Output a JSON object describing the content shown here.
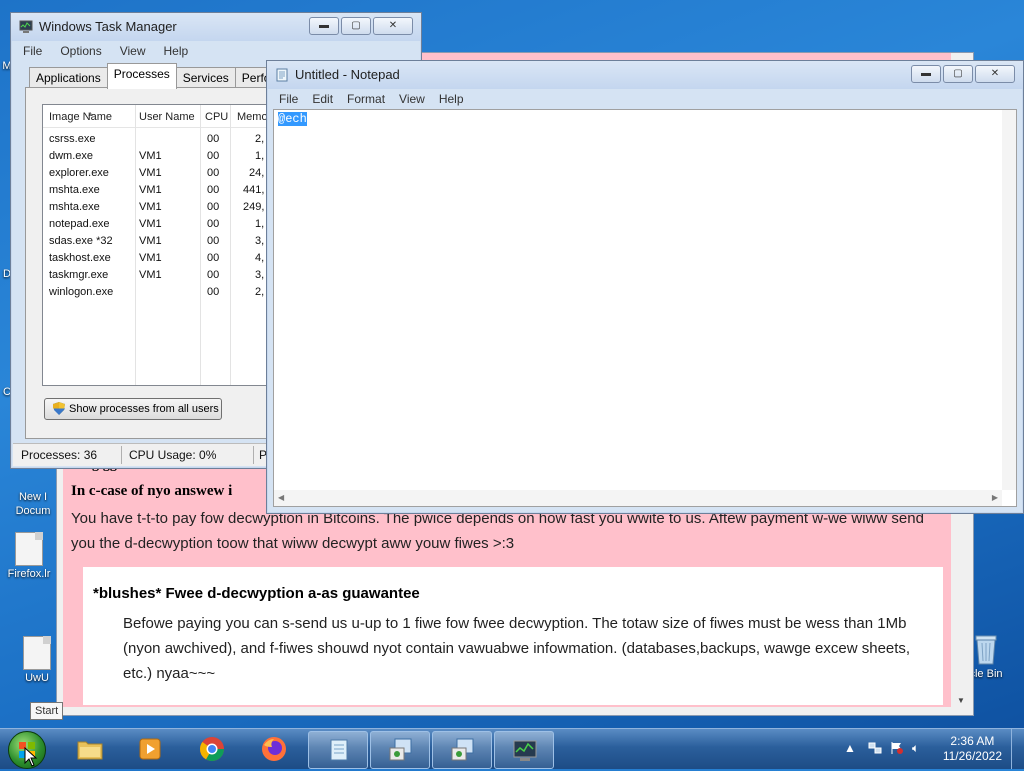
{
  "desktop": {
    "icons": [
      {
        "label": "M",
        "id": "m"
      },
      {
        "label": "D",
        "id": "d"
      },
      {
        "label": "C",
        "id": "c"
      },
      {
        "label": "New I\nDocum",
        "id": "newdoc"
      },
      {
        "label": "Firefox.lr",
        "id": "firefox"
      },
      {
        "label": "UwU",
        "id": "uwu"
      },
      {
        "label": "cle Bin",
        "id": "recycle"
      }
    ]
  },
  "ransom": {
    "partial_heading": "*giggles* W-write this ID i",
    "heading": "In c-case of nyo answew i",
    "text": "You have t-t-to pay fow decwyption in Bitcoins. The pwice depends on how fast you wwite to us. Aftew payment w-we wiww send you the d-decwyption toow that wiww decwypt aww youw fiwes >:3",
    "box_title": "*blushes* Fwee d-decwyption a-as guawantee",
    "box_text": "Befowe paying you can s-send us u-up to 1 fiwe fow fwee decwyption. The totaw size of fiwes must be wess than 1Mb (nyon awchived), and f-fiwes shouwd nyot contain vawuabwe infowmation. (databases,backups, wawge excew sheets, etc.) nyaa~~~"
  },
  "taskmgr": {
    "title": "Windows Task Manager",
    "menu": [
      "File",
      "Options",
      "View",
      "Help"
    ],
    "tabs": [
      "Applications",
      "Processes",
      "Services",
      "Performanc"
    ],
    "columns": [
      "Image Name",
      "User Name",
      "CPU",
      "Memor"
    ],
    "rows": [
      {
        "name": "csrss.exe",
        "user": "",
        "cpu": "00",
        "mem": "2,"
      },
      {
        "name": "dwm.exe",
        "user": "VM1",
        "cpu": "00",
        "mem": "1,"
      },
      {
        "name": "explorer.exe",
        "user": "VM1",
        "cpu": "00",
        "mem": "24,"
      },
      {
        "name": "mshta.exe",
        "user": "VM1",
        "cpu": "00",
        "mem": "441,"
      },
      {
        "name": "mshta.exe",
        "user": "VM1",
        "cpu": "00",
        "mem": "249,"
      },
      {
        "name": "notepad.exe",
        "user": "VM1",
        "cpu": "00",
        "mem": "1,"
      },
      {
        "name": "sdas.exe *32",
        "user": "VM1",
        "cpu": "00",
        "mem": "3,"
      },
      {
        "name": "taskhost.exe",
        "user": "VM1",
        "cpu": "00",
        "mem": "4,"
      },
      {
        "name": "taskmgr.exe",
        "user": "VM1",
        "cpu": "00",
        "mem": "3,"
      },
      {
        "name": "winlogon.exe",
        "user": "",
        "cpu": "00",
        "mem": "2,"
      }
    ],
    "show_all_button": "Show processes from all users",
    "status": {
      "processes": "Processes: 36",
      "cpu": "CPU Usage: 0%",
      "third": "P"
    }
  },
  "notepad": {
    "title": "Untitled - Notepad",
    "menu": [
      "File",
      "Edit",
      "Format",
      "View",
      "Help"
    ],
    "text": "@ech"
  },
  "window_controls": {
    "minimize": "▬",
    "maximize": "▢",
    "close": "✕"
  },
  "taskbar": {
    "start_tooltip": "Start",
    "time": "2:36 AM",
    "date": "11/26/2022"
  },
  "colors": {
    "ransom_bg": "#ffc0cb",
    "selection": "#3399ff",
    "taskbar": "#2b5f9c"
  }
}
